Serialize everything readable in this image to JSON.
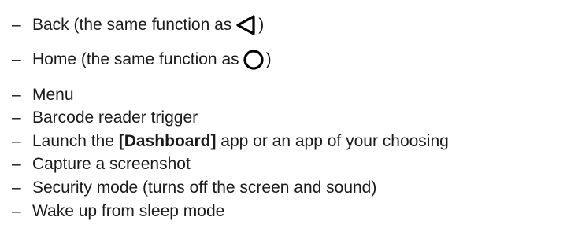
{
  "items": [
    {
      "dash": "–",
      "pre": "Back (the same function as",
      "icon": "back-triangle-icon",
      "post": ")"
    },
    {
      "dash": "–",
      "pre": "Home (the same function as",
      "icon": "home-circle-icon",
      "post": ")"
    },
    {
      "dash": "–",
      "text": "Menu"
    },
    {
      "dash": "–",
      "text": "Barcode reader trigger"
    },
    {
      "dash": "–",
      "pre": "Launch the ",
      "bold": "[Dashboard]",
      "post": " app or an app of your choosing"
    },
    {
      "dash": "–",
      "text": "Capture a screenshot"
    },
    {
      "dash": "–",
      "text": "Security mode (turns off the screen and sound)"
    },
    {
      "dash": "–",
      "text": "Wake up from sleep mode"
    }
  ]
}
